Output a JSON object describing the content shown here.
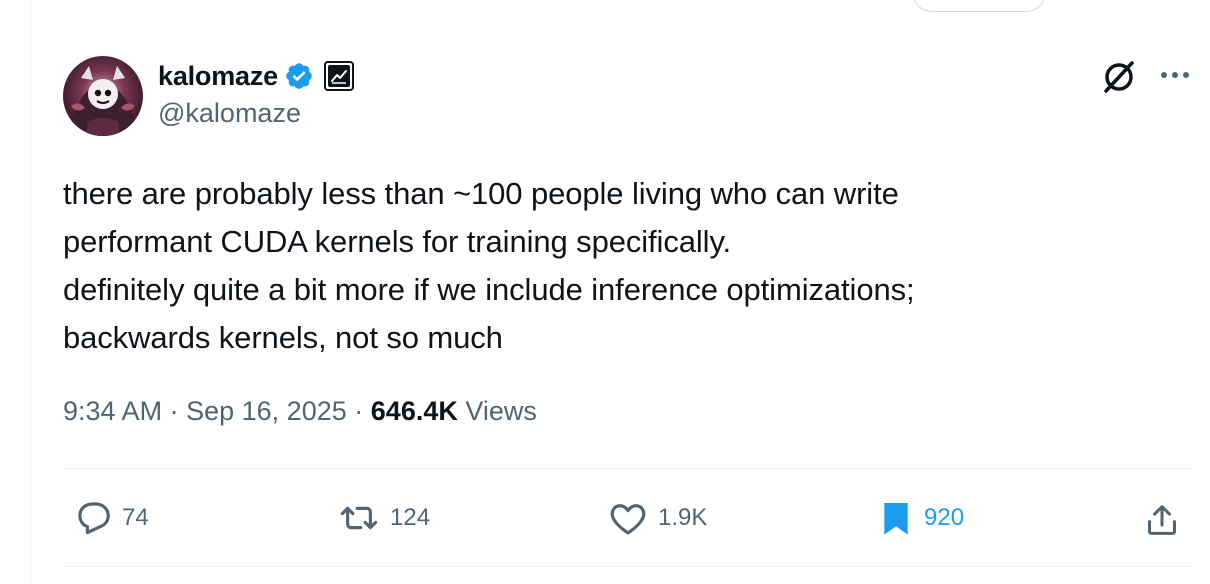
{
  "author": {
    "display_name": "kalomaze",
    "handle": "@kalomaze",
    "verified": true,
    "avatar_icon": "avatar-image"
  },
  "tweet": {
    "lines": [
      "there are probably less than ~100 people living who can write",
      "performant CUDA kernels for training specifically.",
      "definitely quite a bit more if we include inference optimizations;",
      "backwards kernels, not so much"
    ]
  },
  "meta": {
    "time": "9:34 AM",
    "separator": "·",
    "date": "Sep 16, 2025",
    "views_count": "646.4K",
    "views_label": "Views"
  },
  "actions": {
    "replies": "74",
    "reposts": "124",
    "likes": "1.9K",
    "bookmarks": "920"
  },
  "colors": {
    "accent": "#1d9bf0",
    "text_primary": "#0f1419",
    "text_secondary": "#536471",
    "divider": "#eff3f4"
  }
}
